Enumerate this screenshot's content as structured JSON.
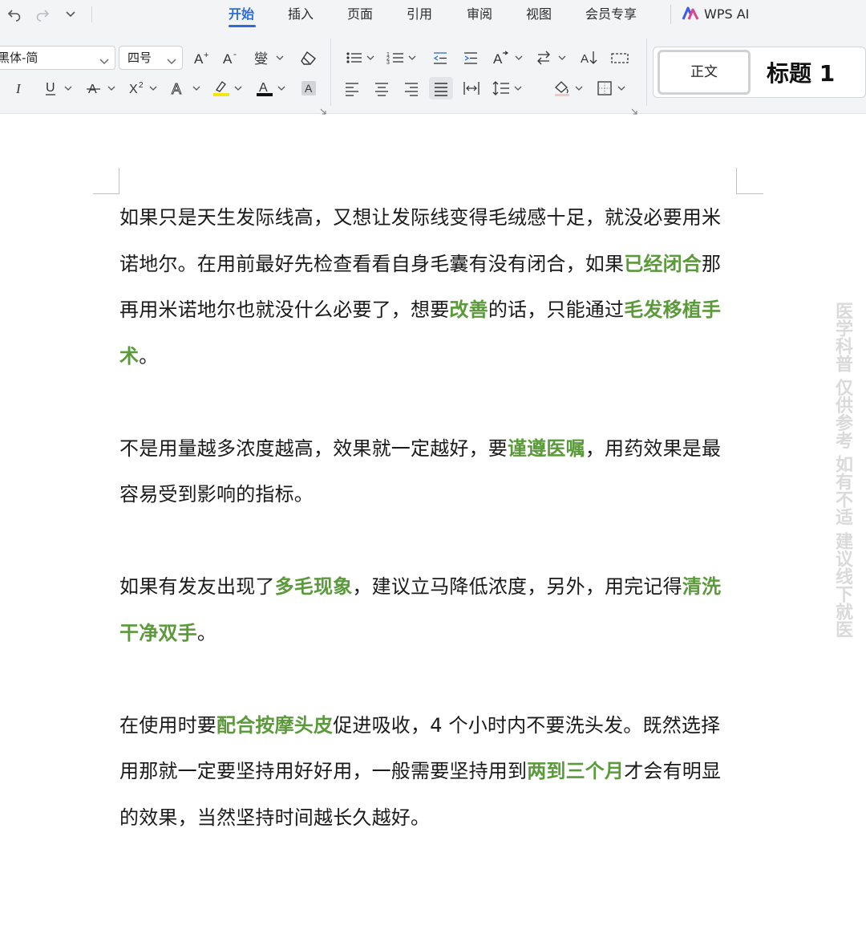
{
  "menubar": {
    "tabs": [
      {
        "label": "开始",
        "active": true
      },
      {
        "label": "插入",
        "active": false
      },
      {
        "label": "页面",
        "active": false
      },
      {
        "label": "引用",
        "active": false
      },
      {
        "label": "审阅",
        "active": false
      },
      {
        "label": "视图",
        "active": false
      },
      {
        "label": "会员专享",
        "active": false
      }
    ],
    "ai_label": "WPS AI"
  },
  "ribbon": {
    "font_name": "黑体-简",
    "font_size": "四号",
    "styles": {
      "normal": "正文",
      "heading1": "标题 1"
    }
  },
  "document": {
    "paragraphs": [
      [
        {
          "text": "如果只是天生发际线高，又想让发际线变得毛绒感十足，就没必要用米诺地尔。在用前最好先检查看看自身毛囊有没有闭合，如果",
          "highlight": false
        },
        {
          "text": "已经闭合",
          "highlight": true
        },
        {
          "text": "那再用米诺地尔也就没什么必要了，想要",
          "highlight": false
        },
        {
          "text": "改善",
          "highlight": true
        },
        {
          "text": "的话，只能通过",
          "highlight": false
        },
        {
          "text": "毛发移植手术",
          "highlight": true
        },
        {
          "text": "。",
          "highlight": false
        }
      ],
      [
        {
          "text": "不是用量越多浓度越高，效果就一定越好，要",
          "highlight": false
        },
        {
          "text": "谨遵医嘱",
          "highlight": true
        },
        {
          "text": "，用药效果是最容易受到影响的指标。",
          "highlight": false
        }
      ],
      [
        {
          "text": "如果有发友出现了",
          "highlight": false
        },
        {
          "text": "多毛现象",
          "highlight": true
        },
        {
          "text": "，建议立马降低浓度，另外，用完记得",
          "highlight": false
        },
        {
          "text": "清洗干净双手",
          "highlight": true
        },
        {
          "text": "。",
          "highlight": false
        }
      ],
      [
        {
          "text": "在使用时要",
          "highlight": false
        },
        {
          "text": "配合按摩头皮",
          "highlight": true
        },
        {
          "text": "促进吸收，4 个小时内不要洗头发。既然选择用那就一定要坚持用好好用，一般需要坚持用到",
          "highlight": false
        },
        {
          "text": "两到三个月",
          "highlight": true
        },
        {
          "text": "才会有明显的效果，当然坚持时间越长久越好。",
          "highlight": false
        }
      ]
    ],
    "watermark": "医学科普 仅供参考 如有不适 建议线下就医"
  },
  "colors": {
    "accent": "#2f6bd8",
    "highlight_text": "#5b9a3a",
    "toolbar_bg": "#f3f4f6"
  }
}
